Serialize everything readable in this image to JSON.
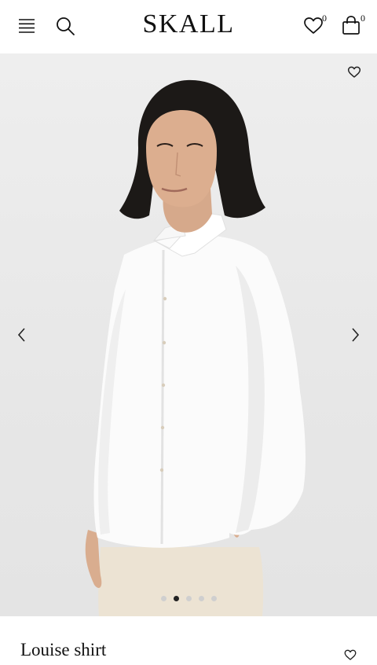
{
  "header": {
    "logo": "SKALL",
    "wishlist_count": "0",
    "bag_count": "0"
  },
  "icons": {
    "menu": "menu-icon",
    "search": "search-icon",
    "wishlist": "heart-icon",
    "bag": "shopping-bag-icon",
    "prev": "chevron-left-icon",
    "next": "chevron-right-icon"
  },
  "gallery": {
    "image_alt": "Model wearing white Louise shirt",
    "slide_count": 5,
    "active_slide": 2
  },
  "product": {
    "name": "Louise shirt"
  },
  "colors": {
    "background": "#ffffff",
    "image_bg": "#e9e9e9",
    "text": "#111111"
  }
}
